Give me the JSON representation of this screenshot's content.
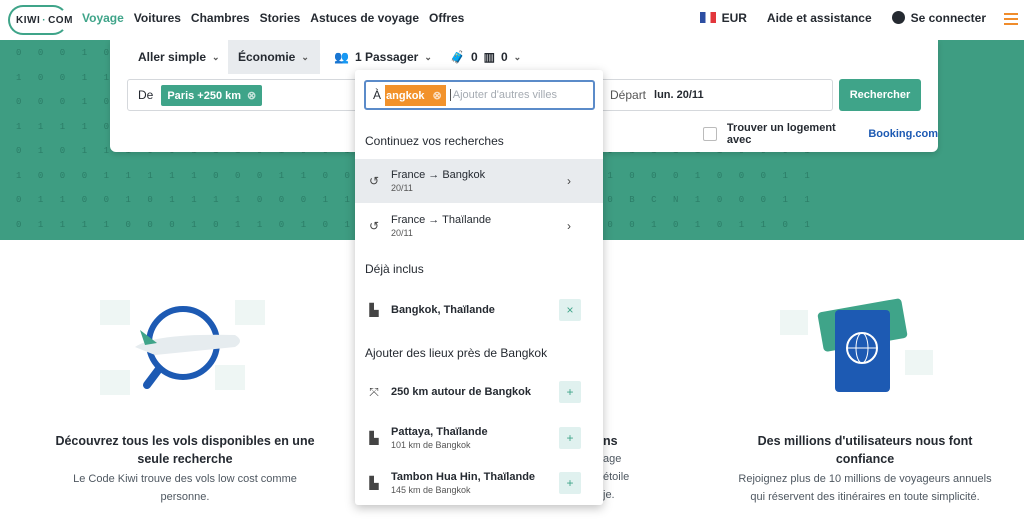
{
  "header": {
    "logo": "KIWI·COM",
    "nav": [
      "Voyage",
      "Voitures",
      "Chambres",
      "Stories",
      "Astuces de voyage",
      "Offres"
    ],
    "currency": "EUR",
    "help": "Aide et assistance",
    "login": "Se connecter"
  },
  "search": {
    "trip_type": "Aller simple",
    "cabin": "Économie",
    "passengers": "1 Passager",
    "cabin_bags": "0",
    "checked_bags": "0",
    "from_label": "De",
    "from_chip": "Paris +250 km",
    "to_label": "À",
    "to_chip": "angkok",
    "to_placeholder": "Ajouter d'autres villes",
    "depart_label": "Départ",
    "depart_value": "lun. 20/11",
    "search_button": "Rechercher",
    "booking_text": "Trouver un logement avec",
    "booking_brand": "Booking.com"
  },
  "dropdown": {
    "recent_title": "Continuez vos recherches",
    "recent": [
      {
        "title": "France → Bangkok",
        "sub": "20/11"
      },
      {
        "title": "France → Thaïlande",
        "sub": "20/11"
      }
    ],
    "included_title": "Déjà inclus",
    "included": [
      {
        "title": "Bangkok, Thaïlande"
      }
    ],
    "nearby_title": "Ajouter des lieux près de Bangkok",
    "nearby": [
      {
        "title": "250 km autour de Bangkok"
      },
      {
        "title": "Pattaya, Thaïlande",
        "sub": "101 km de Bangkok"
      },
      {
        "title": "Tambon Hua Hin, Thaïlande",
        "sub": "145 km de Bangkok"
      }
    ]
  },
  "pattern_rows": [
    "0001000110011100010001110010001100011",
    "1001100101001110010011010011001100100",
    "0001011100100011010001110100101011001",
    "1111000101010011100110101001110010001",
    "0101110011101001001110011000111110001",
    "1000111110001100001111100011000100011",
    "0110010111100011BCN100001100BCN100011",
    "0111100010110101000110001100010101101"
  ],
  "features": [
    {
      "title": "Découvrez tous les vols disponibles en une seule recherche",
      "text": "Le Code Kiwi trouve des vols low cost comme personne."
    },
    {
      "title": "ns",
      "text": "age étoile je."
    },
    {
      "title": "Des millions d'utilisateurs nous font confiance",
      "text": "Rejoignez plus de 10 millions de voyageurs annuels qui réservent des itinéraires en toute simplicité."
    }
  ],
  "colors": {
    "brand": "#3fa489",
    "accent": "#f2922b",
    "link": "#1d5ab3"
  }
}
